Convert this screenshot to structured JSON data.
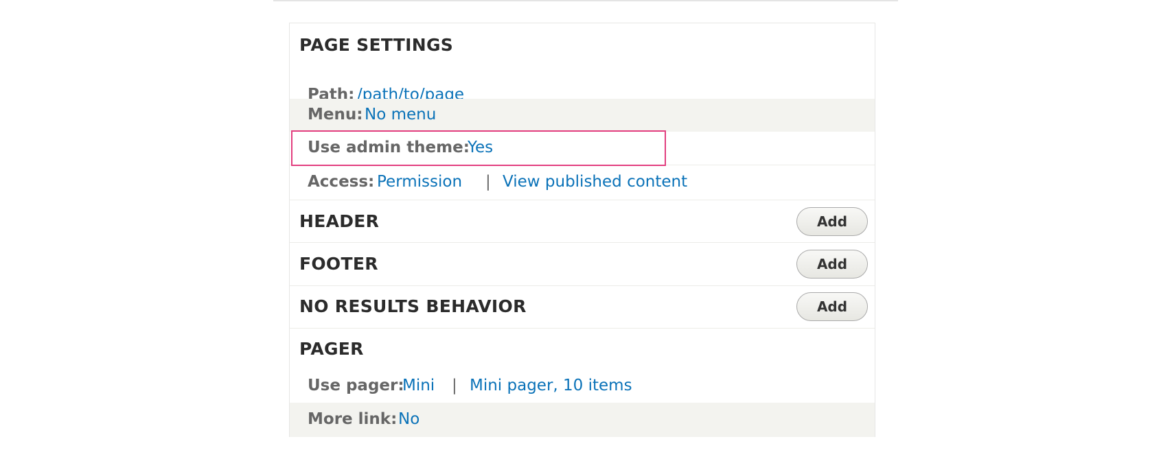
{
  "page_settings": {
    "title": "PAGE SETTINGS",
    "path": {
      "label": "Path:",
      "value": "/path/to/page"
    },
    "menu": {
      "label": "Menu:",
      "value": "No menu"
    },
    "admin_theme": {
      "label": "Use admin theme:",
      "value": "Yes"
    },
    "access": {
      "label": "Access:",
      "value": "Permission",
      "separator": "|",
      "detail": "View published content"
    }
  },
  "header": {
    "title": "HEADER",
    "add_label": "Add"
  },
  "footer": {
    "title": "FOOTER",
    "add_label": "Add"
  },
  "no_results": {
    "title": "NO RESULTS BEHAVIOR",
    "add_label": "Add"
  },
  "pager": {
    "title": "PAGER",
    "use_pager": {
      "label": "Use pager:",
      "value": "Mini",
      "separator": "|",
      "detail": "Mini pager, 10 items"
    },
    "more_link": {
      "label": "More link:",
      "value": "No"
    }
  },
  "colors": {
    "link": "#0a72b8",
    "highlight": "#e23d7e",
    "row_shade": "#f3f3ef"
  }
}
